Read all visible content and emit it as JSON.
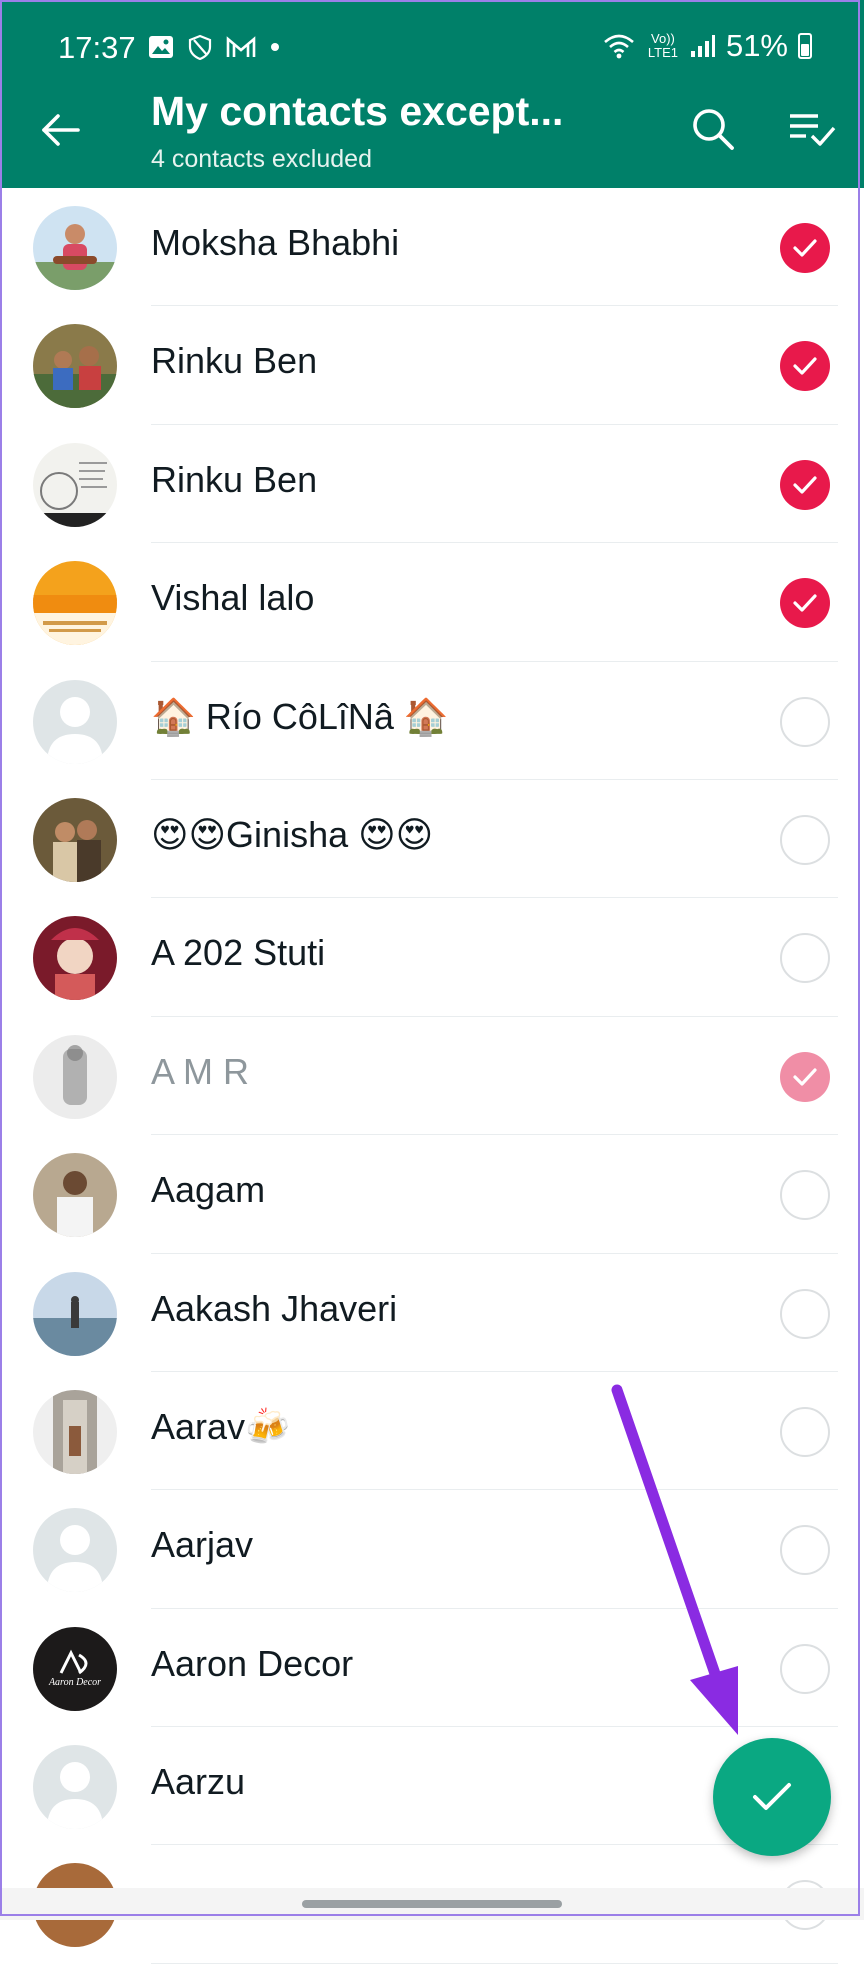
{
  "status_bar": {
    "time": "17:37",
    "battery": "51%",
    "network": "Vo)) LTE1"
  },
  "header": {
    "title": "My contacts except...",
    "subtitle": "4 contacts excluded"
  },
  "contacts": [
    {
      "name": "Moksha Bhabhi",
      "selected": true
    },
    {
      "name": "Rinku Ben",
      "selected": true
    },
    {
      "name": "Rinku Ben",
      "selected": true
    },
    {
      "name": "Vishal lalo",
      "selected": true
    },
    {
      "name": "🏠 Río CôLîNâ 🏠",
      "selected": false
    },
    {
      "name": "😍😍Ginisha 😍😍",
      "selected": false
    },
    {
      "name": "A 202 Stuti",
      "selected": false
    },
    {
      "name": "A M R",
      "selected": true
    },
    {
      "name": "Aagam",
      "selected": false
    },
    {
      "name": "Aakash Jhaveri",
      "selected": false
    },
    {
      "name": "Aarav🍻",
      "selected": false
    },
    {
      "name": "Aarjav",
      "selected": false
    },
    {
      "name": "Aaron Decor",
      "selected": false
    },
    {
      "name": "Aarzu",
      "selected": false
    },
    {
      "name": "",
      "selected": false
    }
  ],
  "avatar_images": {
    "aaron_decor_logo_text": "Aaron Decor"
  },
  "colors": {
    "app_bar": "#008069",
    "check_selected": "#e8194b",
    "fab": "#0aa882",
    "annotation_arrow": "#8a2be2"
  },
  "icons": {
    "back": "back-arrow-icon",
    "search": "search-icon",
    "select_all": "select-all-icon",
    "confirm": "check-icon"
  }
}
